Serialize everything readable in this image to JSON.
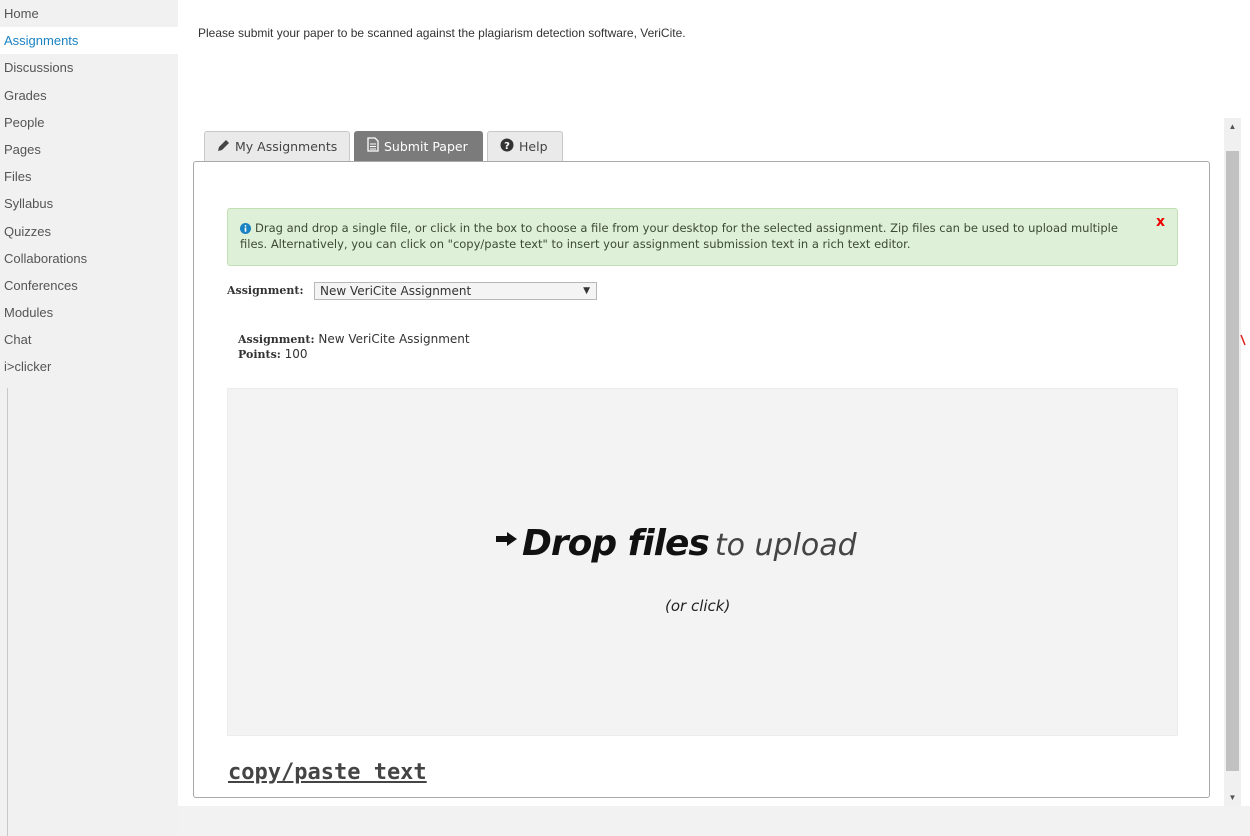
{
  "sidebar": {
    "items": [
      {
        "label": "Home"
      },
      {
        "label": "Assignments"
      },
      {
        "label": "Discussions"
      },
      {
        "label": "Grades"
      },
      {
        "label": "People"
      },
      {
        "label": "Pages"
      },
      {
        "label": "Files"
      },
      {
        "label": "Syllabus"
      },
      {
        "label": "Quizzes"
      },
      {
        "label": "Collaborations"
      },
      {
        "label": "Conferences"
      },
      {
        "label": "Modules"
      },
      {
        "label": "Chat"
      },
      {
        "label": "i>clicker"
      }
    ],
    "active": "Assignments"
  },
  "main": {
    "intro": "Please submit your paper to be scanned against the plagiarism detection software, VeriCite.",
    "tabs": [
      {
        "label": "My Assignments",
        "icon": "pencil-icon"
      },
      {
        "label": "Submit Paper",
        "icon": "document-icon"
      },
      {
        "label": "Help",
        "icon": "question-circle-icon"
      }
    ],
    "active_tab": "Submit Paper",
    "alert": {
      "text": "Drag and drop a single file, or click in the box to choose a file from your desktop for the selected assignment. Zip files can be used to upload multiple files. Alternatively, you can click on \"copy/paste text\" to insert your assignment submission text in a rich text editor.",
      "close": "x"
    },
    "assignment_select": {
      "label": "Assignment:",
      "value": "New VeriCite Assignment"
    },
    "details": {
      "assignment_label": "Assignment:",
      "assignment_value": "New VeriCite Assignment",
      "points_label": "Points:",
      "points_value": "100"
    },
    "dropzone": {
      "strong": "Drop files",
      "light": "to upload",
      "sub": "(or click)"
    },
    "copy_paste": "copy/paste text"
  },
  "colors": {
    "active_nav": "#1a82c3",
    "active_tab_bg": "#7b7b7b",
    "alert_bg": "#dff0d8",
    "alert_close": "#e00000"
  }
}
